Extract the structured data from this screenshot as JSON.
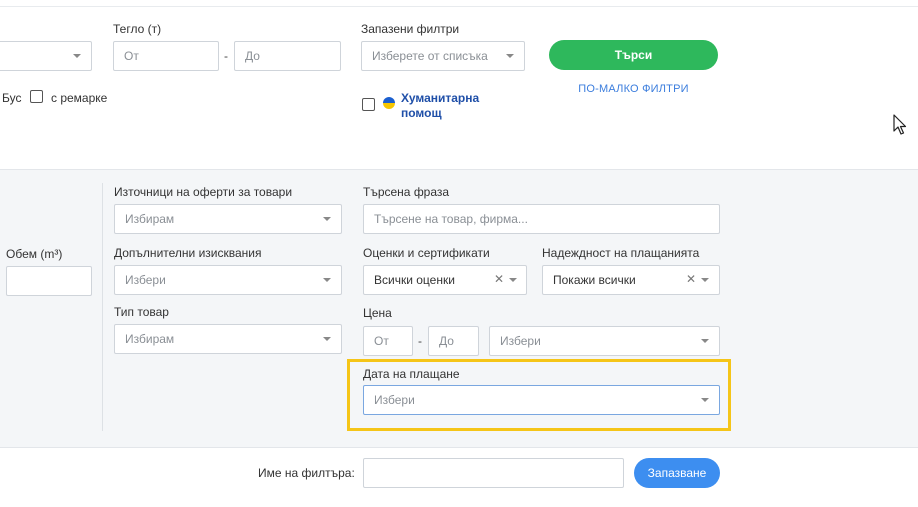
{
  "top": {
    "weight_label": "Тегло (т)",
    "weight_from_placeholder": "От",
    "weight_to_placeholder": "До",
    "saved_filters_label": "Запазени филтри",
    "saved_filters_placeholder": "Изберете от списъка",
    "search_button": "Търси",
    "fewer_filters_link": "ПО-МАЛКО ФИЛТРИ",
    "bus_label": "Бус",
    "trailer_label": "с ремарке",
    "humanitarian_label": "Хуманитарна помощ"
  },
  "filters": {
    "volume_label": "Обем (m³)",
    "sources_label": "Източници на оферти за товари",
    "sources_placeholder": "Избирам",
    "additional_label": "Допълнителни изисквания",
    "additional_placeholder": "Избери",
    "goods_type_label": "Тип товар",
    "goods_type_placeholder": "Избирам",
    "search_phrase_label": "Търсена фраза",
    "search_phrase_placeholder": "Търсене на товар, фирма...",
    "ratings_label": "Оценки и сертификати",
    "ratings_value": "Всички оценки",
    "payment_reliability_label": "Надеждност на плащанията",
    "payment_reliability_value": "Покажи всички",
    "price_label": "Цена",
    "price_from_placeholder": "От",
    "price_to_placeholder": "До",
    "price_currency_placeholder": "Избери",
    "payment_date_label": "Дата на плащане",
    "payment_date_placeholder": "Избери"
  },
  "bottom": {
    "filter_name_label": "Име на филтъра:",
    "save_button": "Запазване"
  },
  "colors": {
    "search_button": "#2eb85c",
    "save_button": "#3d8ef0",
    "highlight_border": "#f5c518",
    "link": "#3b7ddd"
  },
  "icons": {
    "dropdown": "chevron-down-icon",
    "clear": "close-icon",
    "flag": "ukraine-flag-icon",
    "cursor": "mouse-pointer-icon"
  }
}
